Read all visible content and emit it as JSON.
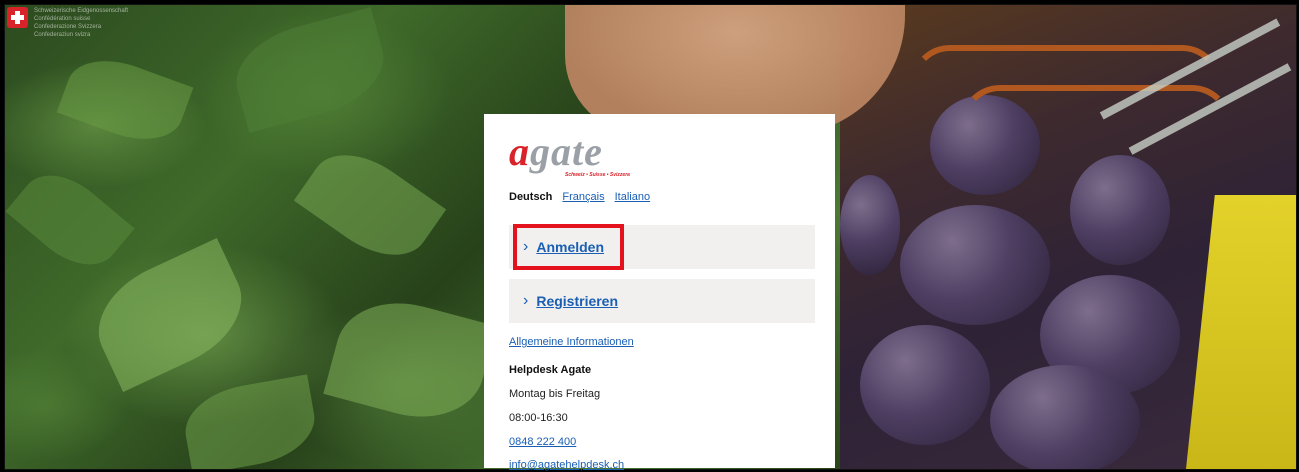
{
  "federal": {
    "lines": [
      "Schweizerische Eidgenossenschaft",
      "Confédération suisse",
      "Confederazione Svizzera",
      "Confederaziun svizra"
    ]
  },
  "logo": {
    "first_letter": "a",
    "rest": "gate",
    "tagline": "Schweiz • Suisse • Svizzera"
  },
  "languages": {
    "active": "Deutsch",
    "french": "Français",
    "italian": "Italiano"
  },
  "actions": {
    "login": "Anmelden",
    "register": "Registrieren"
  },
  "info": {
    "general": "Allgemeine Informationen",
    "helpdesk_title": "Helpdesk Agate",
    "days": "Montag bis Freitag",
    "hours": "08:00-16:30",
    "phone": "0848 222 400",
    "email": "info@agatehelpdesk.ch"
  },
  "colors": {
    "accent": "#1a5fb4",
    "brand_red": "#d8232a",
    "highlight": "#e3121d"
  }
}
